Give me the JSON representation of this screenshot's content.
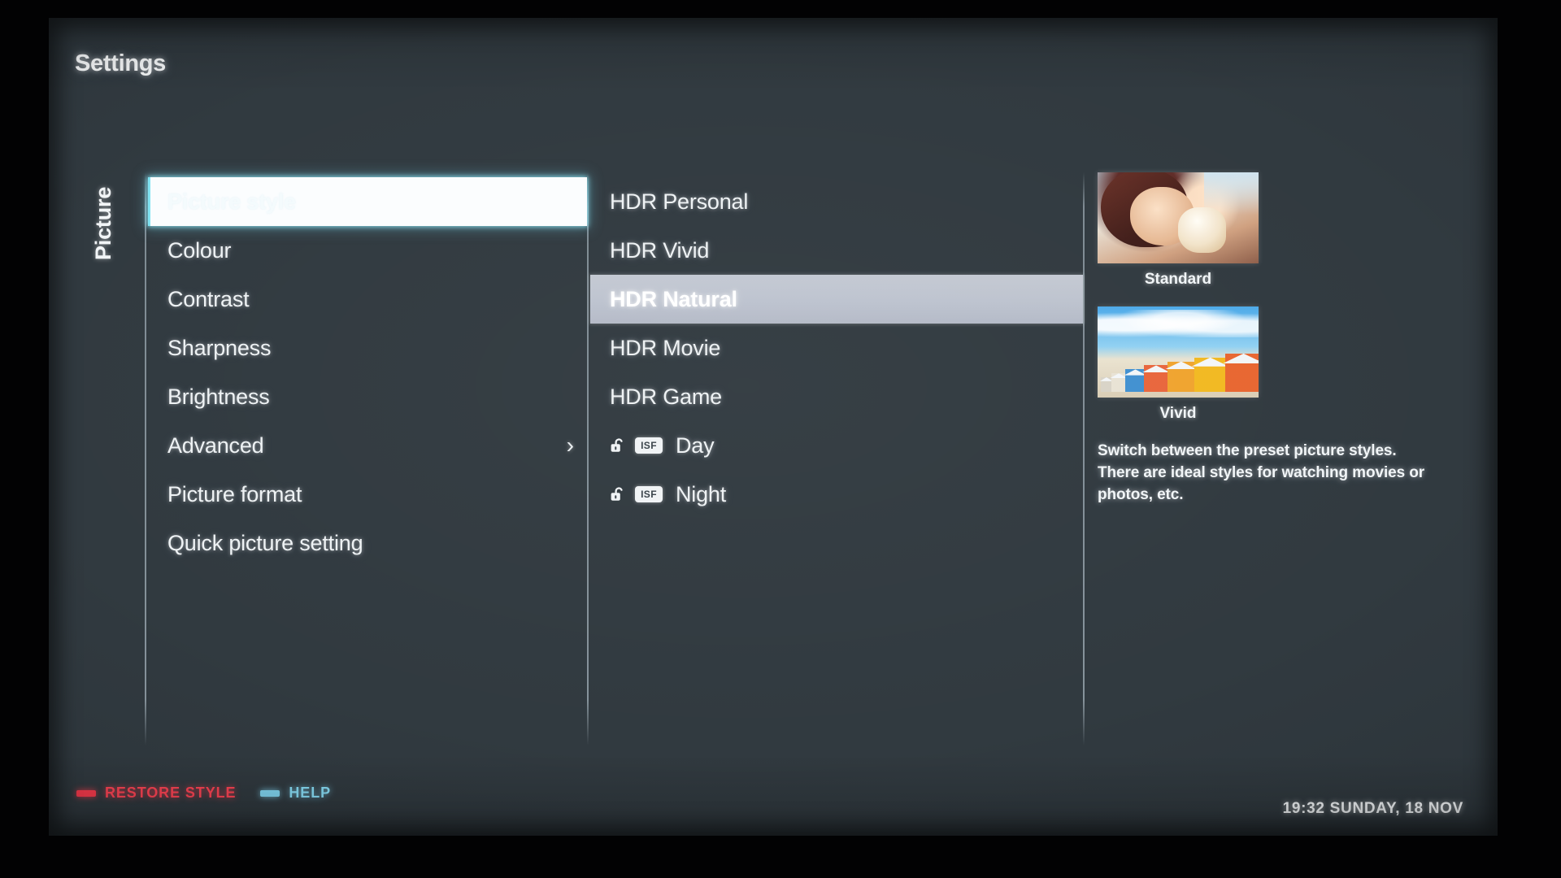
{
  "header": {
    "title": "Settings"
  },
  "category": {
    "label": "Picture"
  },
  "menu": {
    "items": [
      {
        "label": "Picture style",
        "selected": true,
        "chevron": ""
      },
      {
        "label": "Colour",
        "selected": false,
        "chevron": ""
      },
      {
        "label": "Contrast",
        "selected": false,
        "chevron": ""
      },
      {
        "label": "Sharpness",
        "selected": false,
        "chevron": ""
      },
      {
        "label": "Brightness",
        "selected": false,
        "chevron": ""
      },
      {
        "label": "Advanced",
        "selected": false,
        "chevron": "›"
      },
      {
        "label": "Picture format",
        "selected": false,
        "chevron": ""
      },
      {
        "label": "Quick picture setting",
        "selected": false,
        "chevron": ""
      }
    ]
  },
  "options": {
    "items": [
      {
        "label": "HDR Personal",
        "selected": false,
        "locked": false,
        "isf": ""
      },
      {
        "label": "HDR Vivid",
        "selected": false,
        "locked": false,
        "isf": ""
      },
      {
        "label": "HDR Natural",
        "selected": true,
        "locked": false,
        "isf": ""
      },
      {
        "label": "HDR Movie",
        "selected": false,
        "locked": false,
        "isf": ""
      },
      {
        "label": "HDR Game",
        "selected": false,
        "locked": false,
        "isf": ""
      },
      {
        "label": "Day",
        "selected": false,
        "locked": true,
        "isf": "ISF"
      },
      {
        "label": "Night",
        "selected": false,
        "locked": true,
        "isf": "ISF"
      }
    ]
  },
  "preview": {
    "thumbnails": [
      {
        "caption": "Standard",
        "kind": "girl-ice-cream-photo"
      },
      {
        "caption": "Vivid",
        "kind": "beach-huts-photo"
      }
    ],
    "description": "Switch between the preset picture styles. There are ideal styles for watching movies or photos, etc."
  },
  "footer": {
    "keys": [
      {
        "label": "RESTORE STYLE",
        "color": "#fb4252"
      },
      {
        "label": "HELP",
        "color": "#86dcf5"
      }
    ],
    "clock": "19:32 SUNDAY, 18 NOV"
  }
}
